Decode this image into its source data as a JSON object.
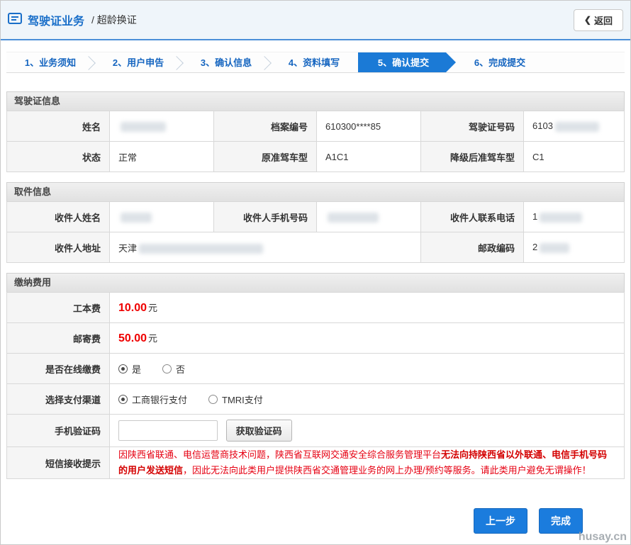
{
  "header": {
    "title": "驾驶证业务",
    "subtitle": "/ 超龄换证",
    "back_chevron": "❮",
    "back_label": "返回"
  },
  "steps": [
    "1、业务须知",
    "2、用户申告",
    "3、确认信息",
    "4、资料填写",
    "5、确认提交",
    "6、完成提交"
  ],
  "active_step": "5、确认提交",
  "license": {
    "title": "驾驶证信息",
    "name_label": "姓名",
    "name_value": "",
    "file_no_label": "档案编号",
    "file_no_value": "610300****85",
    "license_no_label": "驾驶证号码",
    "license_no_value": "6103",
    "status_label": "状态",
    "status_value": "正常",
    "orig_class_label": "原准驾车型",
    "orig_class_value": "A1C1",
    "down_class_label": "降级后准驾车型",
    "down_class_value": "C1"
  },
  "pickup": {
    "title": "取件信息",
    "recipient_name_label": "收件人姓名",
    "recipient_name_value": "",
    "recipient_mobile_label": "收件人手机号码",
    "recipient_mobile_value": "",
    "recipient_phone_label": "收件人联系电话",
    "recipient_phone_value": "1",
    "address_label": "收件人地址",
    "address_value": "天津",
    "postcode_label": "邮政编码",
    "postcode_value": "2"
  },
  "fees": {
    "title": "缴纳费用",
    "work_fee_label": "工本费",
    "work_fee_value": "10.00",
    "work_fee_unit": "元",
    "post_fee_label": "邮寄费",
    "post_fee_value": "50.00",
    "post_fee_unit": "元",
    "online_pay_label": "是否在线缴费",
    "online_yes": "是",
    "online_no": "否",
    "channel_label": "选择支付渠道",
    "channel_icbc": "工商银行支付",
    "channel_tmri": "TMRI支付",
    "sms_code_label": "手机验证码",
    "sms_code_value": "",
    "get_code_button": "获取验证码",
    "notice_label": "短信接收提示",
    "notice_part1": "因陕西省联通、电信运营商技术问题，陕西省互联网交通安全综合服务管理平台",
    "notice_part2": "无法向持陕西省以外联通、电信手机号码的用户发送短信",
    "notice_part3": "，因此无法向此类用户提供陕西省交通管理业务的网上办理/预约等服务。请此类用户避免无谓操作！"
  },
  "footer": {
    "prev_button": "上一步",
    "finish_button": "完成",
    "watermark": "husay.cn"
  },
  "colors": {
    "accent_blue": "#1b7ad6",
    "step_text_blue": "#1565c0",
    "price_red": "#ef0000",
    "notice_red": "#e60012"
  }
}
